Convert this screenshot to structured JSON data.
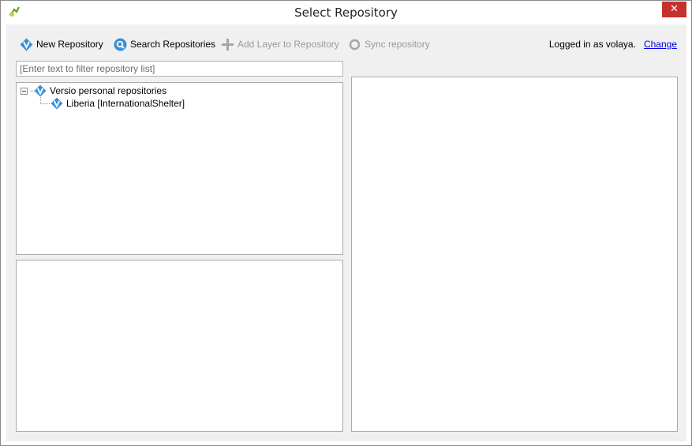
{
  "window": {
    "title": "Select Repository",
    "close_glyph": "✕",
    "app_icon": "qgis-icon"
  },
  "toolbar": {
    "new_repository": {
      "label": "New Repository",
      "icon": "versio-icon",
      "enabled": true
    },
    "search_repositories": {
      "label": "Search Repositories",
      "icon": "search-icon",
      "enabled": true
    },
    "add_layer": {
      "label": "Add Layer to Repository",
      "icon": "plus-icon",
      "enabled": false
    },
    "sync_repository": {
      "label": "Sync repository",
      "icon": "sync-icon",
      "enabled": false
    }
  },
  "login": {
    "status": "Logged in as volaya.",
    "change_label": "Change"
  },
  "filter": {
    "placeholder": "[Enter text to filter repository list]",
    "value": ""
  },
  "tree": {
    "root": {
      "label": "Versio personal repositories",
      "expanded": true
    },
    "children": [
      {
        "label": "Liberia [InternationalShelter]"
      }
    ]
  },
  "colors": {
    "versio_blue": "#3b8fd4",
    "close_red": "#c7312d",
    "link_blue": "#0000ee",
    "dialog_bg": "#f0f0f0",
    "disabled_text": "#9a9a9a"
  }
}
